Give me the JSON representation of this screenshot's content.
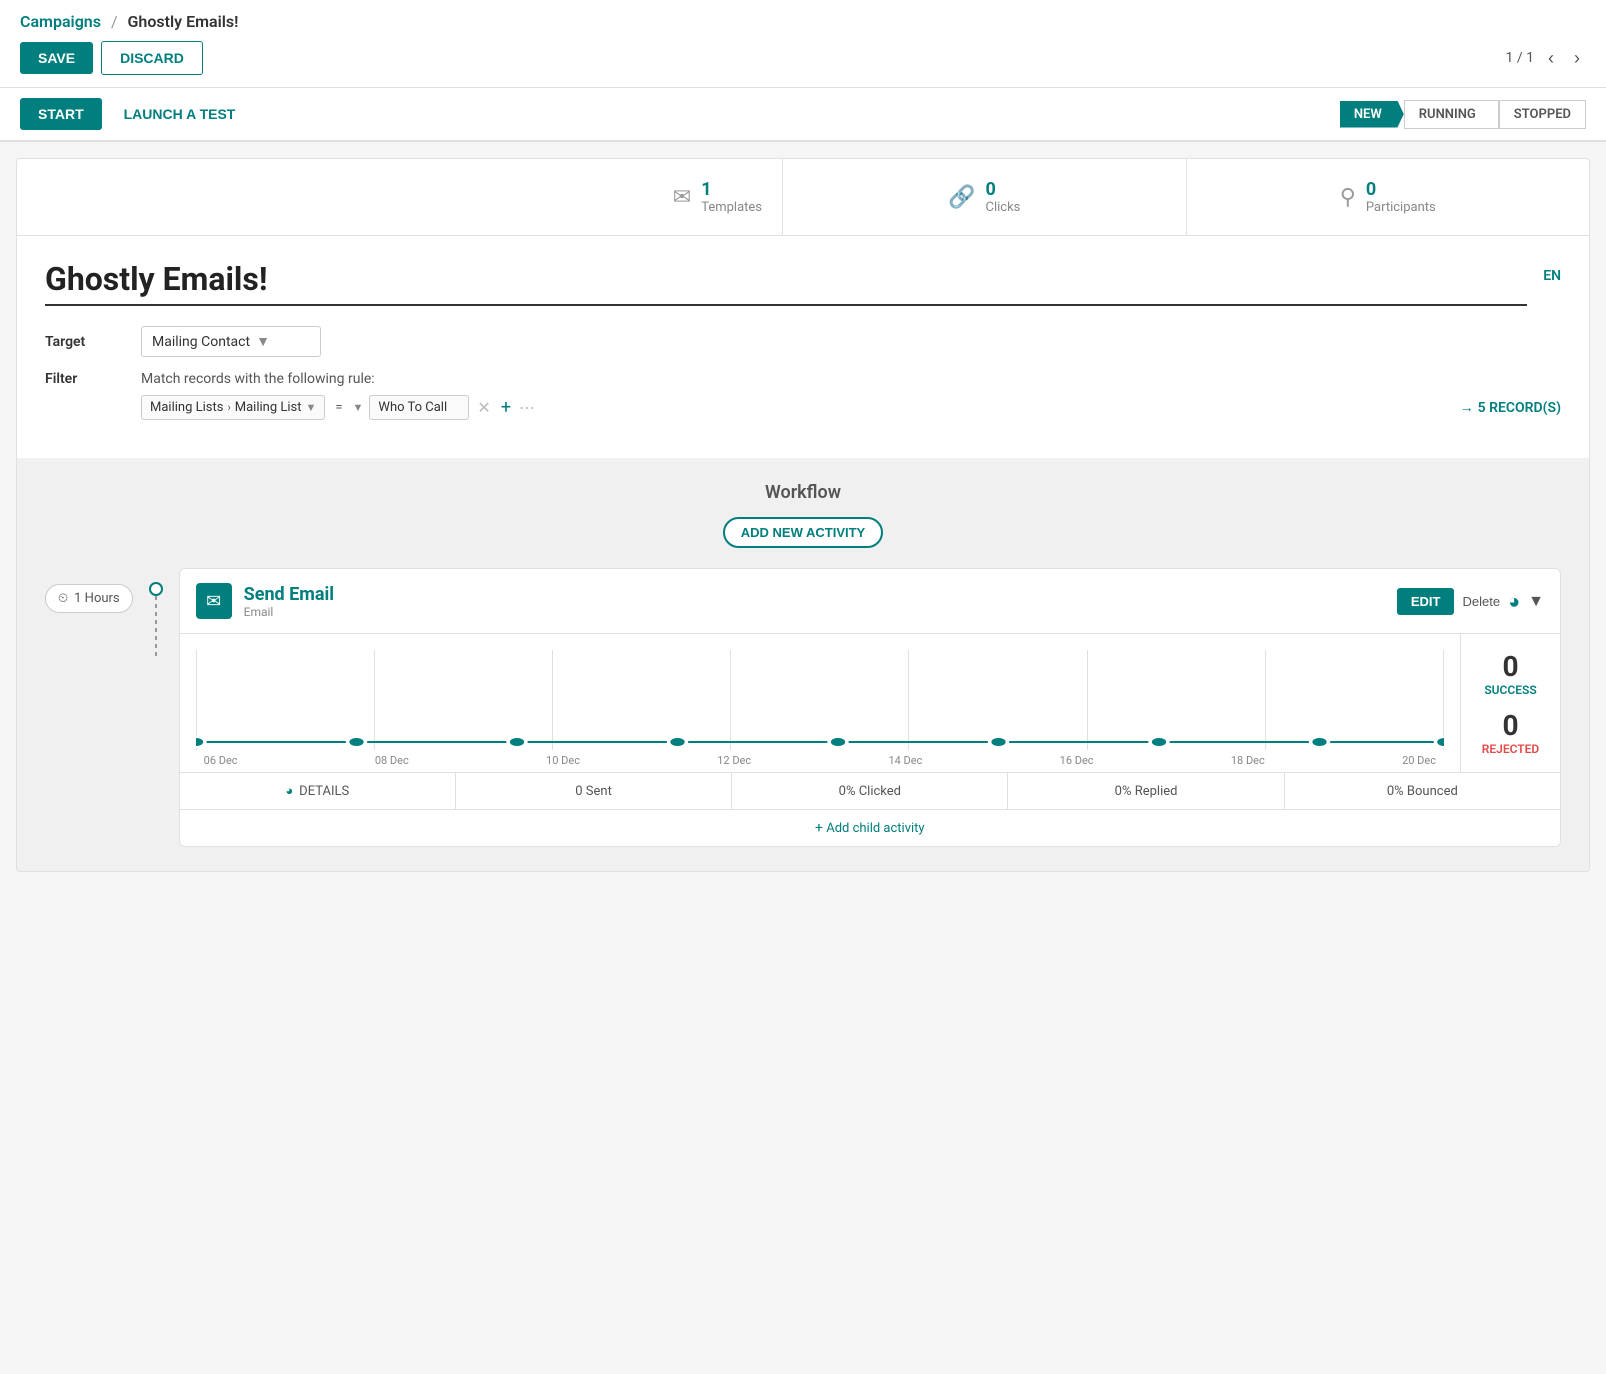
{
  "breadcrumb": {
    "campaigns_label": "Campaigns",
    "separator": "/",
    "current": "Ghostly Emails!"
  },
  "toolbar": {
    "save_label": "SAVE",
    "discard_label": "DISCARD",
    "pagination": "1 / 1"
  },
  "action_bar": {
    "start_label": "START",
    "launch_label": "LAUNCH A TEST"
  },
  "status": {
    "new_label": "NEW",
    "running_label": "RUNNING",
    "stopped_label": "STOPPED"
  },
  "stats": {
    "templates_count": "1",
    "templates_label": "Templates",
    "clicks_count": "0",
    "clicks_label": "Clicks",
    "participants_count": "0",
    "participants_label": "Participants"
  },
  "campaign": {
    "title": "Ghostly Emails!",
    "lang": "EN",
    "target_label": "Target",
    "target_value": "Mailing Contact",
    "filter_label": "Filter",
    "filter_desc": "Match records with the following rule:",
    "records_count": "5 RECORD(S)",
    "filter_chip1": "Mailing Lists",
    "filter_chip1_arrow": "›",
    "filter_chip2": "Mailing List",
    "filter_equals": "=",
    "filter_value": "Who To Call"
  },
  "workflow": {
    "title": "Workflow",
    "add_button": "ADD NEW ACTIVITY",
    "time_label": "1 Hours",
    "activity": {
      "name": "Send Email",
      "type": "Email",
      "edit_label": "EDIT",
      "delete_label": "Delete",
      "chart_dates": [
        "06 Dec",
        "08 Dec",
        "10 Dec",
        "12 Dec",
        "14 Dec",
        "16 Dec",
        "18 Dec",
        "20 Dec"
      ],
      "success_count": "0",
      "success_label": "SUCCESS",
      "rejected_count": "0",
      "rejected_label": "REJECTED",
      "details_label": "DETAILS",
      "sent_label": "0 Sent",
      "clicked_label": "0% Clicked",
      "replied_label": "0% Replied",
      "bounced_label": "0% Bounced",
      "add_child_label": "Add child activity"
    }
  }
}
